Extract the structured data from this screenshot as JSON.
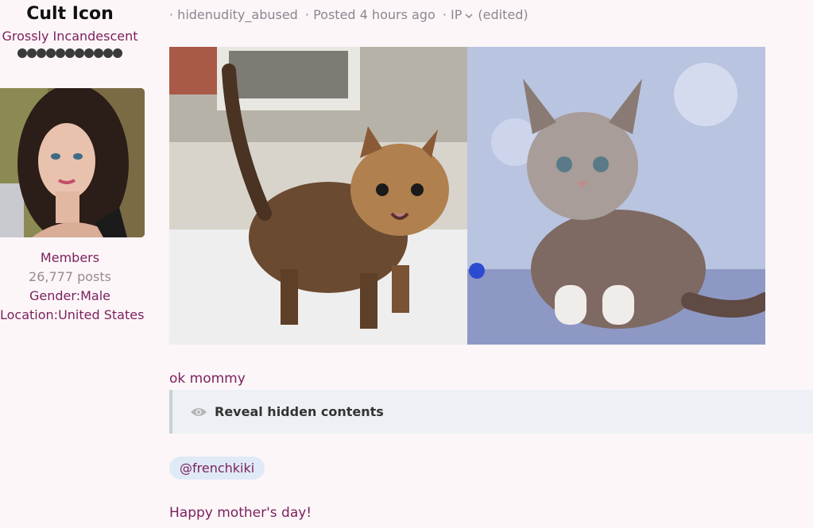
{
  "author": {
    "name": "Cult Icon",
    "title": "Grossly Incandescent",
    "rank_dot_count": 11,
    "group": "Members",
    "posts": "26,777 posts",
    "gender": "Gender:Male",
    "location": "Location:United States"
  },
  "post": {
    "meta": {
      "username": "· hidenudity_abused",
      "posted": "· Posted 4 hours ago",
      "ip": "· IP",
      "edited": "(edited)"
    },
    "images": [
      "kitten-tabby-photo",
      "kitten-fluffy-photo"
    ],
    "reply_text": "ok mommy",
    "spoiler_label": "Reveal hidden contents",
    "mention": "@frenchkiki",
    "closing_text": "Happy mother's day!"
  },
  "colors": {
    "background": "#fcf6f8",
    "accent": "#7b1f5c",
    "muted": "#8d8590",
    "spoiler_bg": "#edf1f5",
    "mention_bg": "#dfeaf6"
  }
}
